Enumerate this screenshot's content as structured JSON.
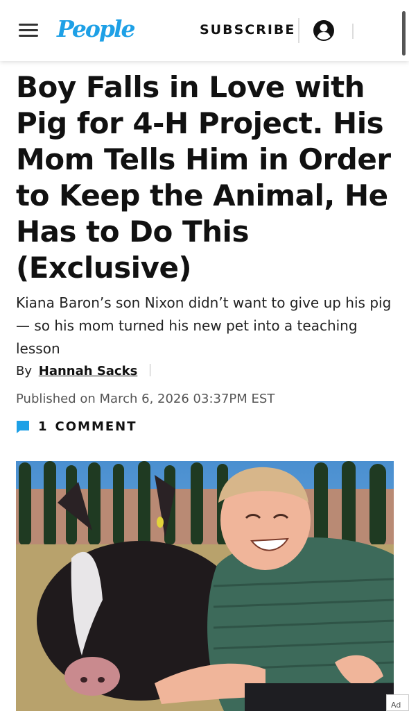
{
  "header": {
    "logo": "People",
    "subscribe_label": "SUBSCRIBE",
    "icons": [
      "menu-icon",
      "user-icon"
    ],
    "brand_color": "#1ea0e6"
  },
  "article": {
    "headline": "Boy Falls in Love with Pig for 4-H Project. His Mom Tells Him in Order to Keep the Animal, He Has to Do This (Exclusive)",
    "dek": "Kiana Baron’s son Nixon didn’t want to give up his pig — so his mom turned his new pet into a teaching lesson",
    "by_label": "By",
    "author": "Hannah Sacks",
    "published": "Published on March 6, 2026 03:37PM EST",
    "comment_count": "1",
    "comment_label": "COMMENT",
    "comment_icon_color": "#1ea0e6"
  },
  "ad_label": "Ad"
}
